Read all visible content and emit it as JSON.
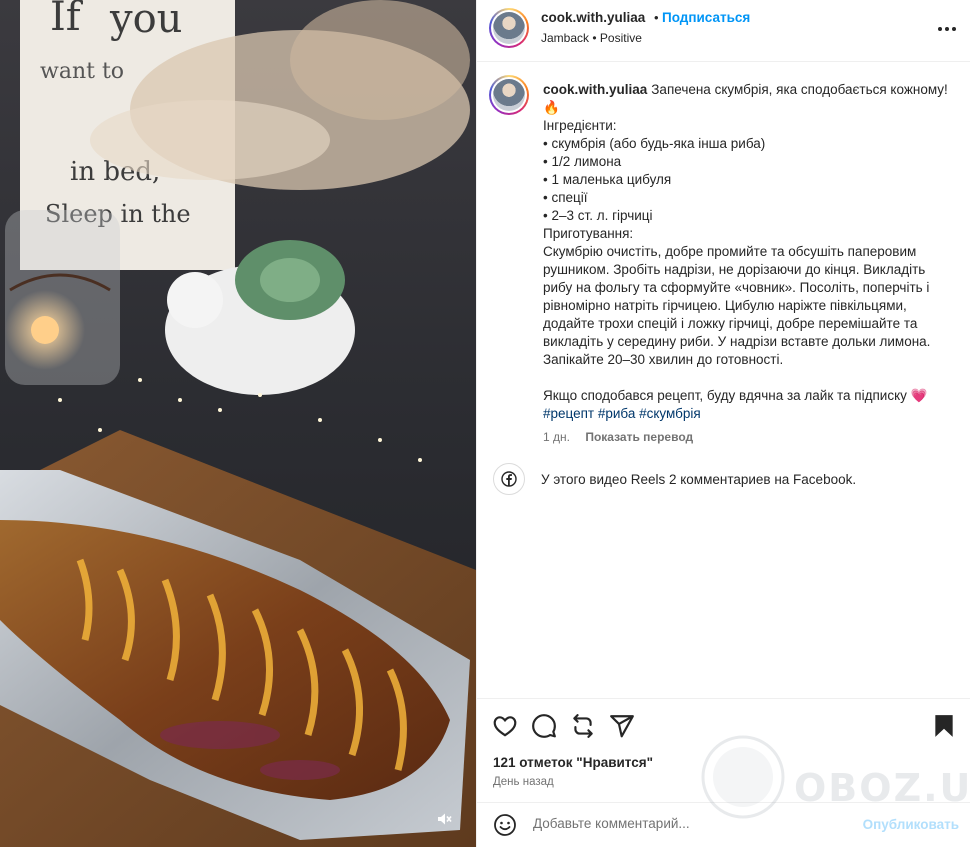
{
  "post": {
    "username": "cook.with.yuliaa",
    "separator": "•",
    "follow_label": "Подписаться",
    "audio_line": "Jamback • Positive",
    "more_icon": "more-horizontal-icon"
  },
  "caption": {
    "username": "cook.with.yuliaa",
    "text": "Запечена скумбрія, яка сподобається кожному! 🔥\nІнгредієнти:\n• скумбрія (або будь-яка інша риба)\n• 1/2 лимона\n• 1 маленька цибуля\n• спеції\n• 2–3 ст. л. гірчиці\nПриготування:\nСкумбрію очистіть, добре промийте та обсушіть паперовим рушником. Зробіть надрізи, не дорізаючи до кінця. Викладіть рибу на фольгу та сформуйте «човник». Посоліть, поперчіть і рівномірно натріть гірчицею. Цибулю наріжте півкільцями, додайте трохи спецій і ложку гірчиці, добре перемішайте та викладіть у середину риби. У надрізи вставте дольки лимона. Запікайте 20–30 хвилин до готовності.\n\nЯкщо сподобався рецепт, буду вдячна за лайк та підписку 💗\n",
    "hashtags": "#рецепт #риба #скумбрія",
    "age": "1 дн.",
    "translate_label": "Показать перевод"
  },
  "facebook_note": "У этого видео Reels 2 комментариев на Facebook.",
  "actions": {
    "likes": "121 отметок \"Нравится\"",
    "time": "День назад"
  },
  "comment_box": {
    "placeholder": "Добавьте комментарий...",
    "publish_label": "Опубликовать"
  },
  "media": {
    "sign_text_lines": [
      "If you",
      "want to",
      "in bed,",
      "Sleep in the"
    ]
  },
  "watermark": "OBOZ.UA",
  "colors": {
    "follow": "#0095f6",
    "hashtag": "#00376b",
    "publish_disabled": "#b2dffc"
  }
}
